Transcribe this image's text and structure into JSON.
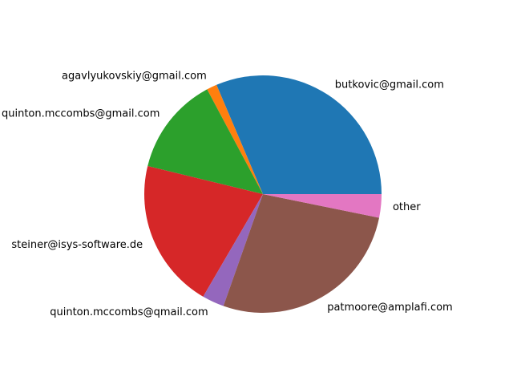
{
  "chart_data": {
    "type": "pie",
    "title": "",
    "start_angle_deg": 0,
    "direction": "counterclockwise",
    "slices": [
      {
        "label": "butkovic@gmail.com",
        "value": 31.4,
        "color": "#1f77b4"
      },
      {
        "label": "agavlyukovskiy@gmail.com",
        "value": 1.4,
        "color": "#ff7f0e"
      },
      {
        "label": "quinton.mccombs@gmail.com",
        "value": 13.4,
        "color": "#2ca02c"
      },
      {
        "label": "steiner@isys-software.de",
        "value": 20.4,
        "color": "#d62728"
      },
      {
        "label": "quinton.mccombs@qmail.com",
        "value": 3.0,
        "color": "#9467bd"
      },
      {
        "label": "patmoore@amplafi.com",
        "value": 27.2,
        "color": "#8c564b"
      },
      {
        "label": "other",
        "value": 3.2,
        "color": "#e377c2"
      }
    ]
  }
}
